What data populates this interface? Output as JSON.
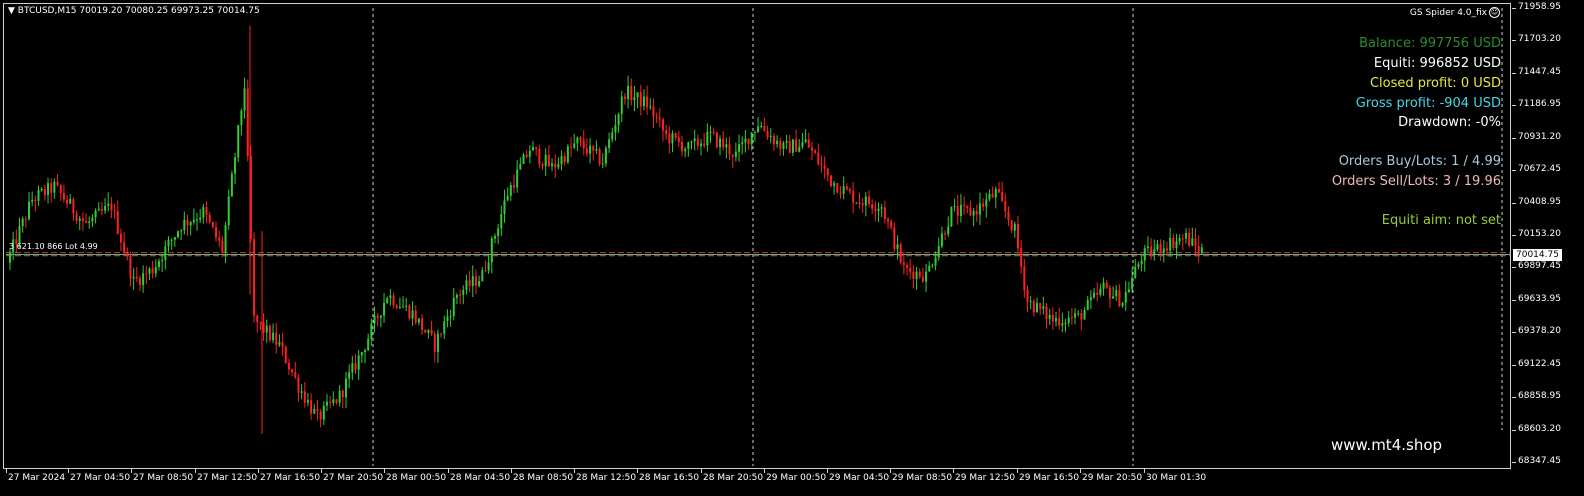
{
  "header": {
    "symbol_info": "BTCUSD,M15  70019.20 70080.25 69973.25 70014.75"
  },
  "ea": {
    "name": "GS Spider 4.0_fix",
    "status_icon": "smiley-icon"
  },
  "stats": {
    "balance": "Balance: 997756 USD",
    "equity": "Equiti: 996852 USD",
    "closed_profit": "Closed profit: 0 USD",
    "gross_profit": "Gross profit: -904 USD",
    "drawdown": "Drawdown: -0%",
    "orders_buy": "Orders Buy/Lots: 1 / 4.99",
    "orders_sell": "Orders Sell/Lots: 3 / 19.96",
    "equity_aim": "Equiti aim: not set"
  },
  "colors": {
    "balance": "#2e8b2e",
    "equity": "#ffffff",
    "closed_profit": "#e8e840",
    "gross_profit": "#40d8e8",
    "drawdown": "#ffffff",
    "orders_buy": "#a8c8e0",
    "orders_sell": "#f0b8b8",
    "equity_aim": "#9acd32",
    "bull": "#32cd32",
    "bear": "#ff2020"
  },
  "order_label": "3 621.10 866 Lot 4.99",
  "current_price": "70014.75",
  "watermark": "www.mt4.shop",
  "chart_data": {
    "type": "candlestick",
    "symbol": "BTCUSD",
    "timeframe": "M15",
    "ylim": [
      68347.45,
      71958.95
    ],
    "y_ticks": [
      "71958.95",
      "71703.20",
      "71447.45",
      "71186.95",
      "70931.20",
      "70672.45",
      "70408.95",
      "70153.20",
      "69897.45",
      "69633.95",
      "69378.20",
      "69122.45",
      "68858.95",
      "68603.20",
      "68347.45"
    ],
    "x_ticks": [
      "27 Mar 2024",
      "27 Mar 04:50",
      "27 Mar 08:50",
      "27 Mar 12:50",
      "27 Mar 16:50",
      "27 Mar 20:50",
      "28 Mar 00:50",
      "28 Mar 04:50",
      "28 Mar 08:50",
      "28 Mar 12:50",
      "28 Mar 16:50",
      "28 Mar 20:50",
      "29 Mar 00:50",
      "29 Mar 04:50",
      "29 Mar 08:50",
      "29 Mar 12:50",
      "29 Mar 16:50",
      "29 Mar 20:50",
      "30 Mar 01:30"
    ],
    "current_price": 70014.75,
    "order_lines": [
      70030,
      70005
    ],
    "day_separators": [
      "28 Mar 00:00",
      "29 Mar 00:00",
      "30 Mar 00:00"
    ],
    "trend_anchors": [
      [
        0,
        69950
      ],
      [
        8,
        70450
      ],
      [
        15,
        70550
      ],
      [
        25,
        70250
      ],
      [
        33,
        70400
      ],
      [
        40,
        69800
      ],
      [
        46,
        69900
      ],
      [
        55,
        70250
      ],
      [
        62,
        70350
      ],
      [
        68,
        70050
      ],
      [
        75,
        71350
      ],
      [
        78,
        69500
      ],
      [
        86,
        69300
      ],
      [
        92,
        68980
      ],
      [
        98,
        68720
      ],
      [
        105,
        68900
      ],
      [
        112,
        69250
      ],
      [
        120,
        69700
      ],
      [
        128,
        69550
      ],
      [
        135,
        69300
      ],
      [
        142,
        69700
      ],
      [
        150,
        69850
      ],
      [
        158,
        70500
      ],
      [
        165,
        70850
      ],
      [
        172,
        70700
      ],
      [
        180,
        70900
      ],
      [
        188,
        70750
      ],
      [
        195,
        71300
      ],
      [
        202,
        71200
      ],
      [
        208,
        70950
      ],
      [
        215,
        70850
      ],
      [
        222,
        70950
      ],
      [
        230,
        70800
      ],
      [
        237,
        71050
      ],
      [
        245,
        70850
      ],
      [
        252,
        70900
      ],
      [
        260,
        70600
      ],
      [
        268,
        70450
      ],
      [
        276,
        70400
      ],
      [
        283,
        69900
      ],
      [
        290,
        69850
      ],
      [
        298,
        70350
      ],
      [
        305,
        70350
      ],
      [
        312,
        70500
      ],
      [
        318,
        70200
      ],
      [
        322,
        69650
      ],
      [
        330,
        69500
      ],
      [
        338,
        69520
      ],
      [
        346,
        69750
      ],
      [
        352,
        69650
      ],
      [
        358,
        70000
      ],
      [
        366,
        70100
      ],
      [
        372,
        70150
      ],
      [
        376,
        70050
      ]
    ],
    "candle_count": 377
  }
}
